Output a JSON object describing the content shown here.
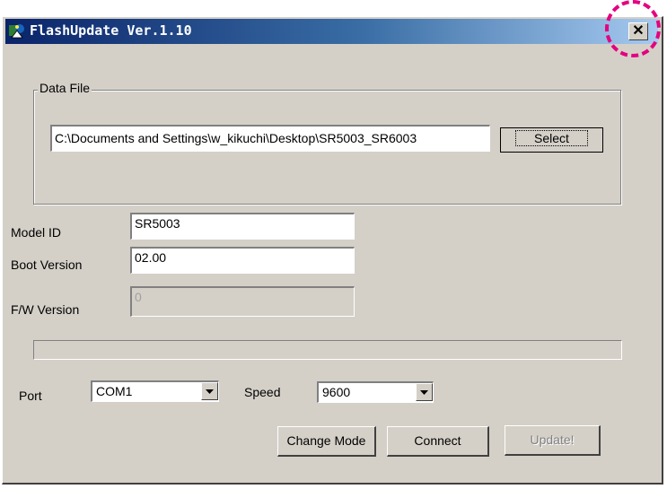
{
  "window": {
    "title": "FlashUpdate Ver.1.10",
    "close_glyph": "✕"
  },
  "data_file": {
    "group_label": "Data File",
    "path_value": "C:\\Documents and Settings\\w_kikuchi\\Desktop\\SR5003_SR6003",
    "select_label": "Select"
  },
  "fields": {
    "model_id_label": "Model ID",
    "model_id_value": "SR5003",
    "boot_version_label": "Boot Version",
    "boot_version_value": "02.00",
    "fw_version_label": "F/W Version",
    "fw_version_value": "0"
  },
  "progress": {
    "fraction": 0
  },
  "serial": {
    "port_label": "Port",
    "port_value": "COM1",
    "speed_label": "Speed",
    "speed_value": "9600"
  },
  "buttons": {
    "change_mode": "Change Mode",
    "connect": "Connect",
    "update": "Update!"
  },
  "colors": {
    "highlight": "#e4007f",
    "title_start": "#0a246a",
    "title_end": "#a6caf0"
  }
}
